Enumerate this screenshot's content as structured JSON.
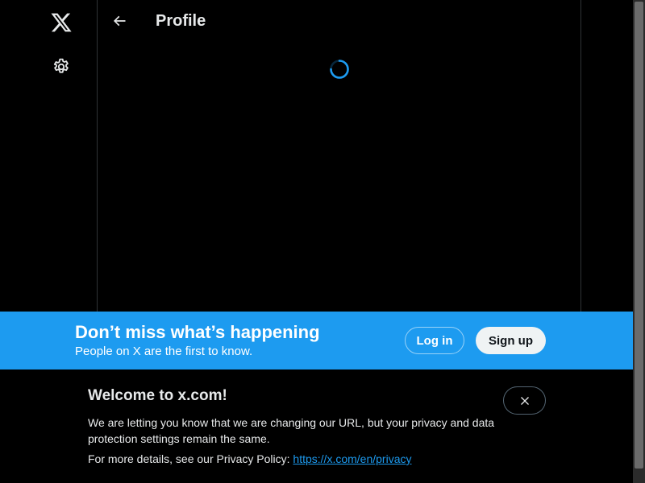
{
  "nav": {
    "logo_icon": "x-logo-icon",
    "settings_icon": "gear-icon"
  },
  "header": {
    "back_icon": "arrow-left-icon",
    "title": "Profile"
  },
  "main": {
    "loading": true
  },
  "banner": {
    "title": "Don’t miss what’s happening",
    "subtitle": "People on X are the first to know.",
    "login_label": "Log in",
    "signup_label": "Sign up"
  },
  "notice": {
    "title": "Welcome to x.com!",
    "body": "We are letting you know that we are changing our URL, but your privacy and data protection settings remain the same.",
    "more_prefix": "For more details, see our Privacy Policy: ",
    "link_text": "https://x.com/en/privacy",
    "close_icon": "close-icon"
  },
  "colors": {
    "background": "#000000",
    "accent": "#1d9bf0",
    "text": "#e7e9ea",
    "border": "#2f3336"
  }
}
